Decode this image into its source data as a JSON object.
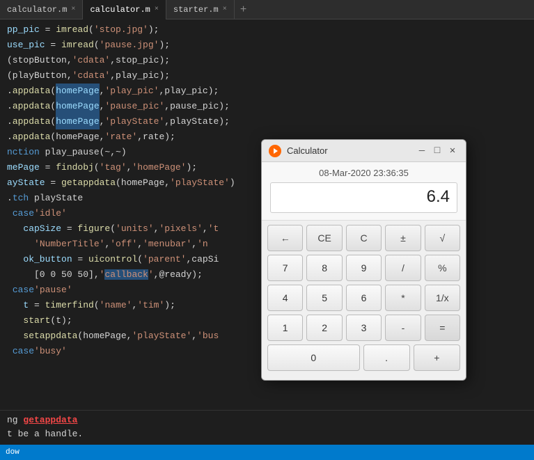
{
  "tabs": [
    {
      "id": "tab1",
      "label": "calculator.m",
      "active": false,
      "dot": true
    },
    {
      "id": "tab2",
      "label": "calculator.m",
      "active": true,
      "dot": false
    },
    {
      "id": "tab3",
      "label": "starter.m",
      "active": false,
      "dot": false
    }
  ],
  "code": {
    "lines": [
      "pp_pic = imread('stop.jpg');",
      "use_pic = imread('pause.jpg');",
      "(stopButton,'cdata',stop_pic);",
      "(playButton,'cdata',play_pic);",
      ".appdata(homePage,'play_pic',play_pic);",
      ".appdata(homePage,'pause_pic',pause_pic);",
      ".appdata(homePage,'playState',playState);",
      ".appdata(homePage,'rate',rate);",
      "nction play_pause(~,~)",
      "mePage = findobj('tag','homePage');",
      "ayState = getappdata(homePage,'playState')",
      ".tch playState",
      " case 'idle'",
      "   capSize = figure('units','pixels','t",
      "     'NumberTitle','off','menubar','n",
      "   ok_button = uicontrol('parent',capSi",
      "     [0 0 50 50],'callback',@ready);",
      " case 'pause'",
      "   t = timerfind('name','tim');",
      "   start(t);",
      "   setappdata(homePage,'playState','bus",
      " case 'busy'"
    ],
    "highlighted_lines": [
      4,
      5,
      6
    ],
    "callback_line": 16
  },
  "output": {
    "lines": [
      {
        "text": "ng getappdata",
        "type": "red-underline"
      },
      {
        "text": "t be a handle.",
        "type": "normal"
      }
    ]
  },
  "calculator": {
    "title": "Calculator",
    "datetime": "08-Mar-2020 23:36:35",
    "display": "6.4",
    "buttons": [
      [
        {
          "label": "←",
          "type": "operator",
          "name": "backspace-btn"
        },
        {
          "label": "CE",
          "type": "operator",
          "name": "ce-btn"
        },
        {
          "label": "C",
          "type": "operator",
          "name": "c-btn"
        },
        {
          "label": "±",
          "type": "operator",
          "name": "plusminus-btn"
        },
        {
          "label": "√",
          "type": "operator",
          "name": "sqrt-btn"
        }
      ],
      [
        {
          "label": "7",
          "type": "number",
          "name": "btn-7"
        },
        {
          "label": "8",
          "type": "number",
          "name": "btn-8"
        },
        {
          "label": "9",
          "type": "number",
          "name": "btn-9"
        },
        {
          "label": "/",
          "type": "operator",
          "name": "divide-btn"
        },
        {
          "label": "%",
          "type": "operator",
          "name": "percent-btn"
        }
      ],
      [
        {
          "label": "4",
          "type": "number",
          "name": "btn-4"
        },
        {
          "label": "5",
          "type": "number",
          "name": "btn-5"
        },
        {
          "label": "6",
          "type": "number",
          "name": "btn-6"
        },
        {
          "label": "*",
          "type": "operator",
          "name": "multiply-btn"
        },
        {
          "label": "1/x",
          "type": "operator",
          "name": "reciprocal-btn"
        }
      ],
      [
        {
          "label": "1",
          "type": "number",
          "name": "btn-1"
        },
        {
          "label": "2",
          "type": "number",
          "name": "btn-2"
        },
        {
          "label": "3",
          "type": "number",
          "name": "btn-3"
        },
        {
          "label": "-",
          "type": "operator",
          "name": "subtract-btn"
        },
        {
          "label": "=",
          "type": "equals",
          "name": "equals-btn"
        }
      ],
      [
        {
          "label": "0",
          "type": "number",
          "name": "btn-0",
          "wide": false
        },
        {
          "label": ".",
          "type": "number",
          "name": "dot-btn"
        },
        {
          "label": "+",
          "type": "operator",
          "name": "add-btn"
        }
      ]
    ],
    "title_buttons": {
      "minimize": "—",
      "maximize": "□",
      "close": "✕"
    }
  },
  "status_bar": {
    "text": "dow"
  }
}
